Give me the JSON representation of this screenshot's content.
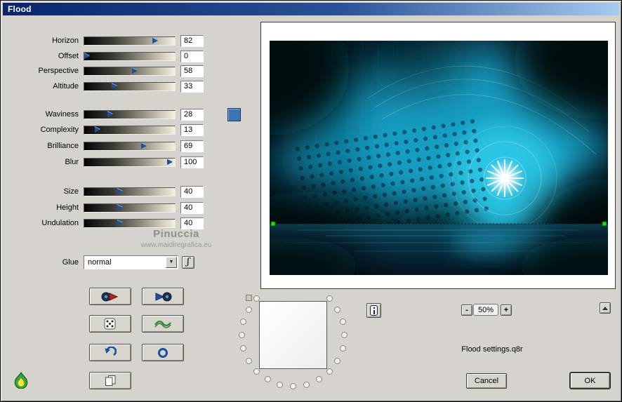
{
  "window": {
    "title": "Flood"
  },
  "sliders": [
    {
      "label": "Horizon",
      "value": 82
    },
    {
      "label": "Offset",
      "value": 0
    },
    {
      "label": "Perspective",
      "value": 58
    },
    {
      "label": "Altitude",
      "value": 33
    },
    {
      "label": "Waviness",
      "value": 28
    },
    {
      "label": "Complexity",
      "value": 13
    },
    {
      "label": "Brilliance",
      "value": 69
    },
    {
      "label": "Blur",
      "value": 100
    },
    {
      "label": "Size",
      "value": 40
    },
    {
      "label": "Height",
      "value": 40
    },
    {
      "label": "Undulation",
      "value": 40
    }
  ],
  "swatch_color": "#3a75b5",
  "glue": {
    "label": "Glue",
    "value": "normal",
    "sync_glyph": "ʃ"
  },
  "watermark": {
    "line1": "Pinuccia",
    "line2": "www.maidiregrafica.eu"
  },
  "preview_controls": {
    "zoom_out": "-",
    "zoom_level": "50%",
    "zoom_in": "+",
    "settings_file": "Flood settings.q8r"
  },
  "actions": {
    "cancel": "Cancel",
    "ok": "OK"
  },
  "icons": [
    "preview-original-icon",
    "preview-filtered-icon",
    "randomize-dice-icon",
    "auto-wave-icon",
    "undo-icon",
    "reset-circle-icon",
    "copy-settings-icon",
    "flame-logo-icon",
    "info-icon",
    "scroll-up-icon",
    "glue-sync-icon"
  ]
}
